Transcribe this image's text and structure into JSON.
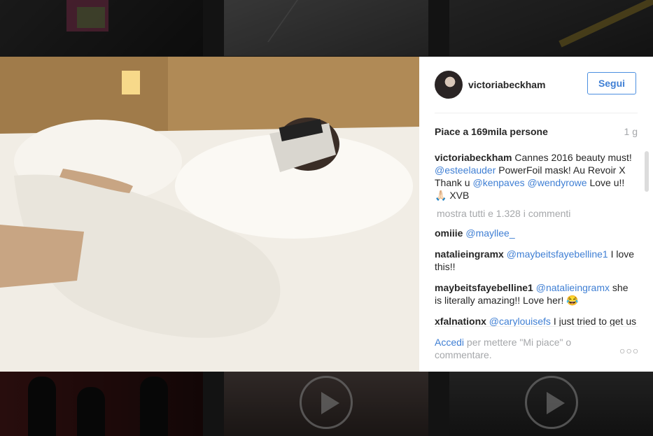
{
  "post": {
    "username": "victoriabeckham",
    "follow_label": "Segui",
    "likes_text": "Piace a 169mila persone",
    "time_ago": "1 g"
  },
  "caption": {
    "user": "victoriabeckham",
    "part1": " Cannes 2016 beauty must! ",
    "mention1": "@esteelauder",
    "part2": " PowerFoil mask! Au Revoir X Thank u ",
    "mention2": "@kenpaves",
    "space": " ",
    "mention3": "@wendyrowe",
    "part3": " Love u!! 🙏🏻 XVB"
  },
  "view_all_comments": "mostra tutti e 1.328 i commenti",
  "comments": [
    {
      "user": "omiiie",
      "mention": "@mayllee_",
      "text": ""
    },
    {
      "user": "natalieingramx",
      "mention": "@maybeitsfayebelline1",
      "text": " I love this!!"
    },
    {
      "user": "maybeitsfayebelline1",
      "mention": "@natalieingramx",
      "text": " she is literally amazing!! Love her! 😂"
    },
    {
      "user": "xfalnationx",
      "mention": "@carylouisefs",
      "text": " I just tried to get us one?!!! Completely sold out"
    }
  ],
  "footer": {
    "login_label": "Accedi",
    "rest": " per mettere \"Mi piace\" o commentare."
  },
  "icons": {
    "more": "more-options-icon",
    "play": "play-icon"
  },
  "colors": {
    "link": "#3f7fd4",
    "muted": "#a5a7aa",
    "text": "#262626"
  }
}
